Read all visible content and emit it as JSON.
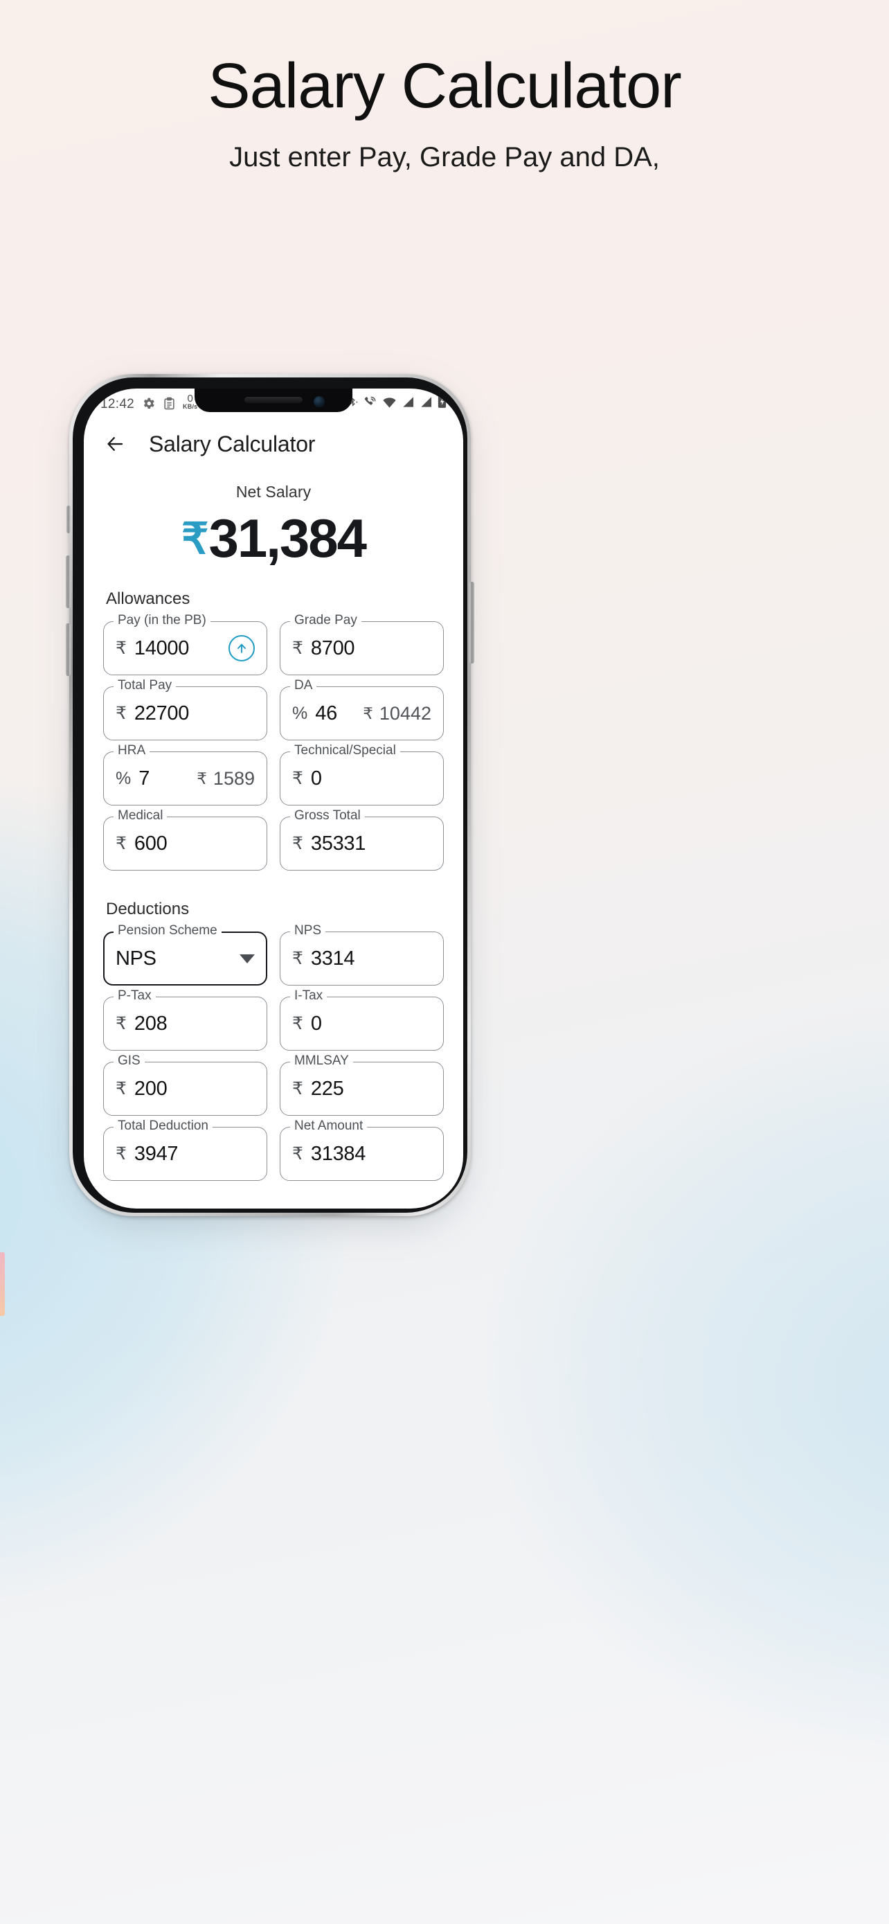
{
  "poster": {
    "title": "Salary Calculator",
    "subtitle": "Just enter Pay, Grade Pay and DA,"
  },
  "colors": {
    "accent": "#1f9cc3",
    "rupee_accent": "#2b9cc4",
    "text_primary": "#16181c",
    "field_border": "#8b9095",
    "select_border": "#16181c"
  },
  "statusbar": {
    "time": "12:42",
    "icons_left": [
      "gear-icon",
      "clipboard-icon"
    ],
    "net_speed_value": "0",
    "net_speed_unit": "KB/s",
    "icons_right": [
      "bluetooth-icon",
      "phone-wifi-icon",
      "wifi-icon",
      "signal-icon",
      "signal-icon",
      "battery-charging-icon"
    ]
  },
  "appbar": {
    "back_icon": "arrow-left-icon",
    "title": "Salary Calculator"
  },
  "net_salary": {
    "label": "Net Salary",
    "currency": "₹",
    "amount": "31,384"
  },
  "allowances": {
    "section_title": "Allowances",
    "fields": [
      {
        "label": "Pay (in the PB)",
        "prefix": "₹",
        "value": "14000",
        "trailing_icon": "arrow-up-circle-icon"
      },
      {
        "label": "Grade Pay",
        "prefix": "₹",
        "value": "8700"
      },
      {
        "label": "Total Pay",
        "prefix": "₹",
        "value": "22700"
      },
      {
        "label": "DA",
        "prefix": "%",
        "value": "46",
        "right_prefix": "₹",
        "right_value": "10442"
      },
      {
        "label": "HRA",
        "prefix": "%",
        "value": "7",
        "right_prefix": "₹",
        "right_value": "1589"
      },
      {
        "label": "Technical/Special",
        "prefix": "₹",
        "value": "0"
      },
      {
        "label": "Medical",
        "prefix": "₹",
        "value": "600"
      },
      {
        "label": "Gross Total",
        "prefix": "₹",
        "value": "35331"
      }
    ]
  },
  "deductions": {
    "section_title": "Deductions",
    "pension": {
      "label": "Pension Scheme",
      "value": "NPS",
      "caret_icon": "chevron-down-icon"
    },
    "fields": [
      {
        "label": "NPS",
        "prefix": "₹",
        "value": "3314"
      },
      {
        "label": "P-Tax",
        "prefix": "₹",
        "value": "208"
      },
      {
        "label": "I-Tax",
        "prefix": "₹",
        "value": "0"
      },
      {
        "label": "GIS",
        "prefix": "₹",
        "value": "200"
      },
      {
        "label": "MMLSAY",
        "prefix": "₹",
        "value": "225"
      },
      {
        "label": "Total Deduction",
        "prefix": "₹",
        "value": "3947"
      },
      {
        "label": "Net Amount",
        "prefix": "₹",
        "value": "31384"
      }
    ]
  }
}
